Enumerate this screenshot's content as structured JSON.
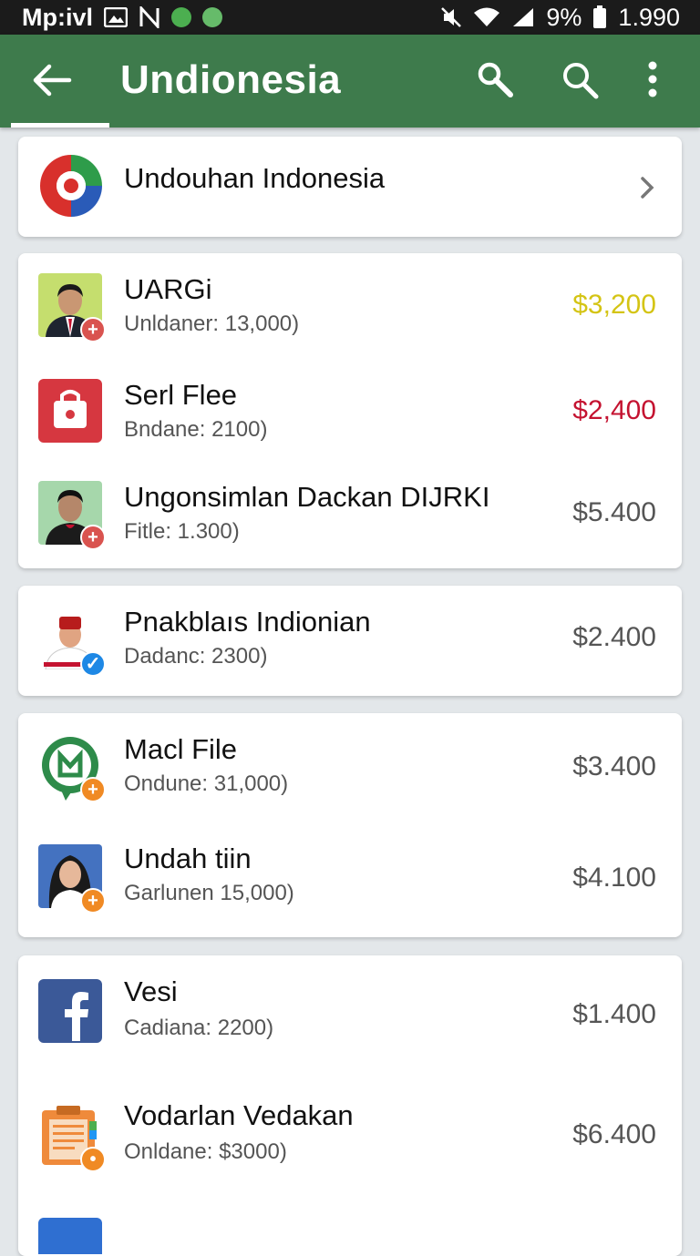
{
  "status_bar": {
    "left_text": "Mp:ivl",
    "battery": "9%",
    "time": "1.990",
    "icons": [
      "gallery-icon",
      "n-icon",
      "phone-call-icon",
      "green-app-icon",
      "mute-icon",
      "wifi-icon",
      "signal-icon",
      "battery-icon"
    ]
  },
  "appbar": {
    "title": "Undionesia",
    "icons": [
      "back-arrow-icon",
      "key-search-icon",
      "search-icon",
      "more-vert-icon"
    ]
  },
  "header_card": {
    "title": "Undouhan Indonesia",
    "icon": "circular-logo-icon",
    "chevron": "chevron-right-icon"
  },
  "items": [
    {
      "name": "UARGi",
      "sub": "Unldaner: 13,000)",
      "price": "$3,200",
      "price_color": "#d4c414",
      "avatar": "man-portrait"
    },
    {
      "name": "Serl Flee",
      "sub": "Bndane: 2100)",
      "price": "$2,400",
      "price_color": "#c41230",
      "avatar": "red-bag-icon"
    },
    {
      "name": "Ungonsimlan Dackan DIJRKI",
      "sub": "Fitle:  1.300)",
      "price": "$5.400",
      "price_color": "#555555",
      "avatar": "man-portrait"
    },
    {
      "name": "Pnakblaıs Indionian",
      "sub": "Dadanc: 2300)",
      "price": "$2.400",
      "price_color": "#555555",
      "avatar": "man-in-fez"
    },
    {
      "name": "Macl File",
      "sub": "Ondune: 31,000)",
      "price": "$3.400",
      "price_color": "#555555",
      "avatar": "green-chat-icon"
    },
    {
      "name": "Undah tiin",
      "sub": "Garlunen 15,000)",
      "price": "$4.100",
      "price_color": "#555555",
      "avatar": "woman-portrait"
    },
    {
      "name": "Vesi",
      "sub": "Cadiana: 2200)",
      "price": "$1.400",
      "price_color": "#555555",
      "avatar": "facebook-icon"
    },
    {
      "name": "Vodarlan Vedakan",
      "sub": "Onldane: $3000)",
      "price": "$6.400",
      "price_color": "#555555",
      "avatar": "document-icon"
    }
  ]
}
